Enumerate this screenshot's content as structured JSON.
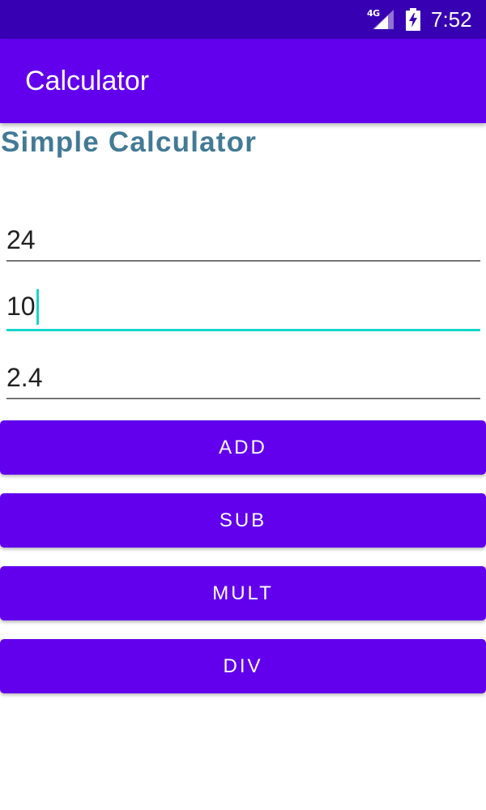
{
  "status_bar": {
    "network": "4G",
    "time": "7:52",
    "icons": [
      "signal-icon",
      "battery-charging-icon"
    ]
  },
  "app_bar": {
    "title": "Calculator"
  },
  "heading": "Simple Calculator",
  "inputs": [
    {
      "value": "24",
      "focused": false
    },
    {
      "value": "10",
      "focused": true
    },
    {
      "value": "2.4",
      "focused": false
    }
  ],
  "buttons": [
    {
      "label": "ADD"
    },
    {
      "label": "SUB"
    },
    {
      "label": "MULT"
    },
    {
      "label": "DIV"
    }
  ],
  "colors": {
    "status_bar": "#3700b3",
    "primary": "#6200ee",
    "accent": "#14d6c8",
    "heading": "#437a95"
  }
}
